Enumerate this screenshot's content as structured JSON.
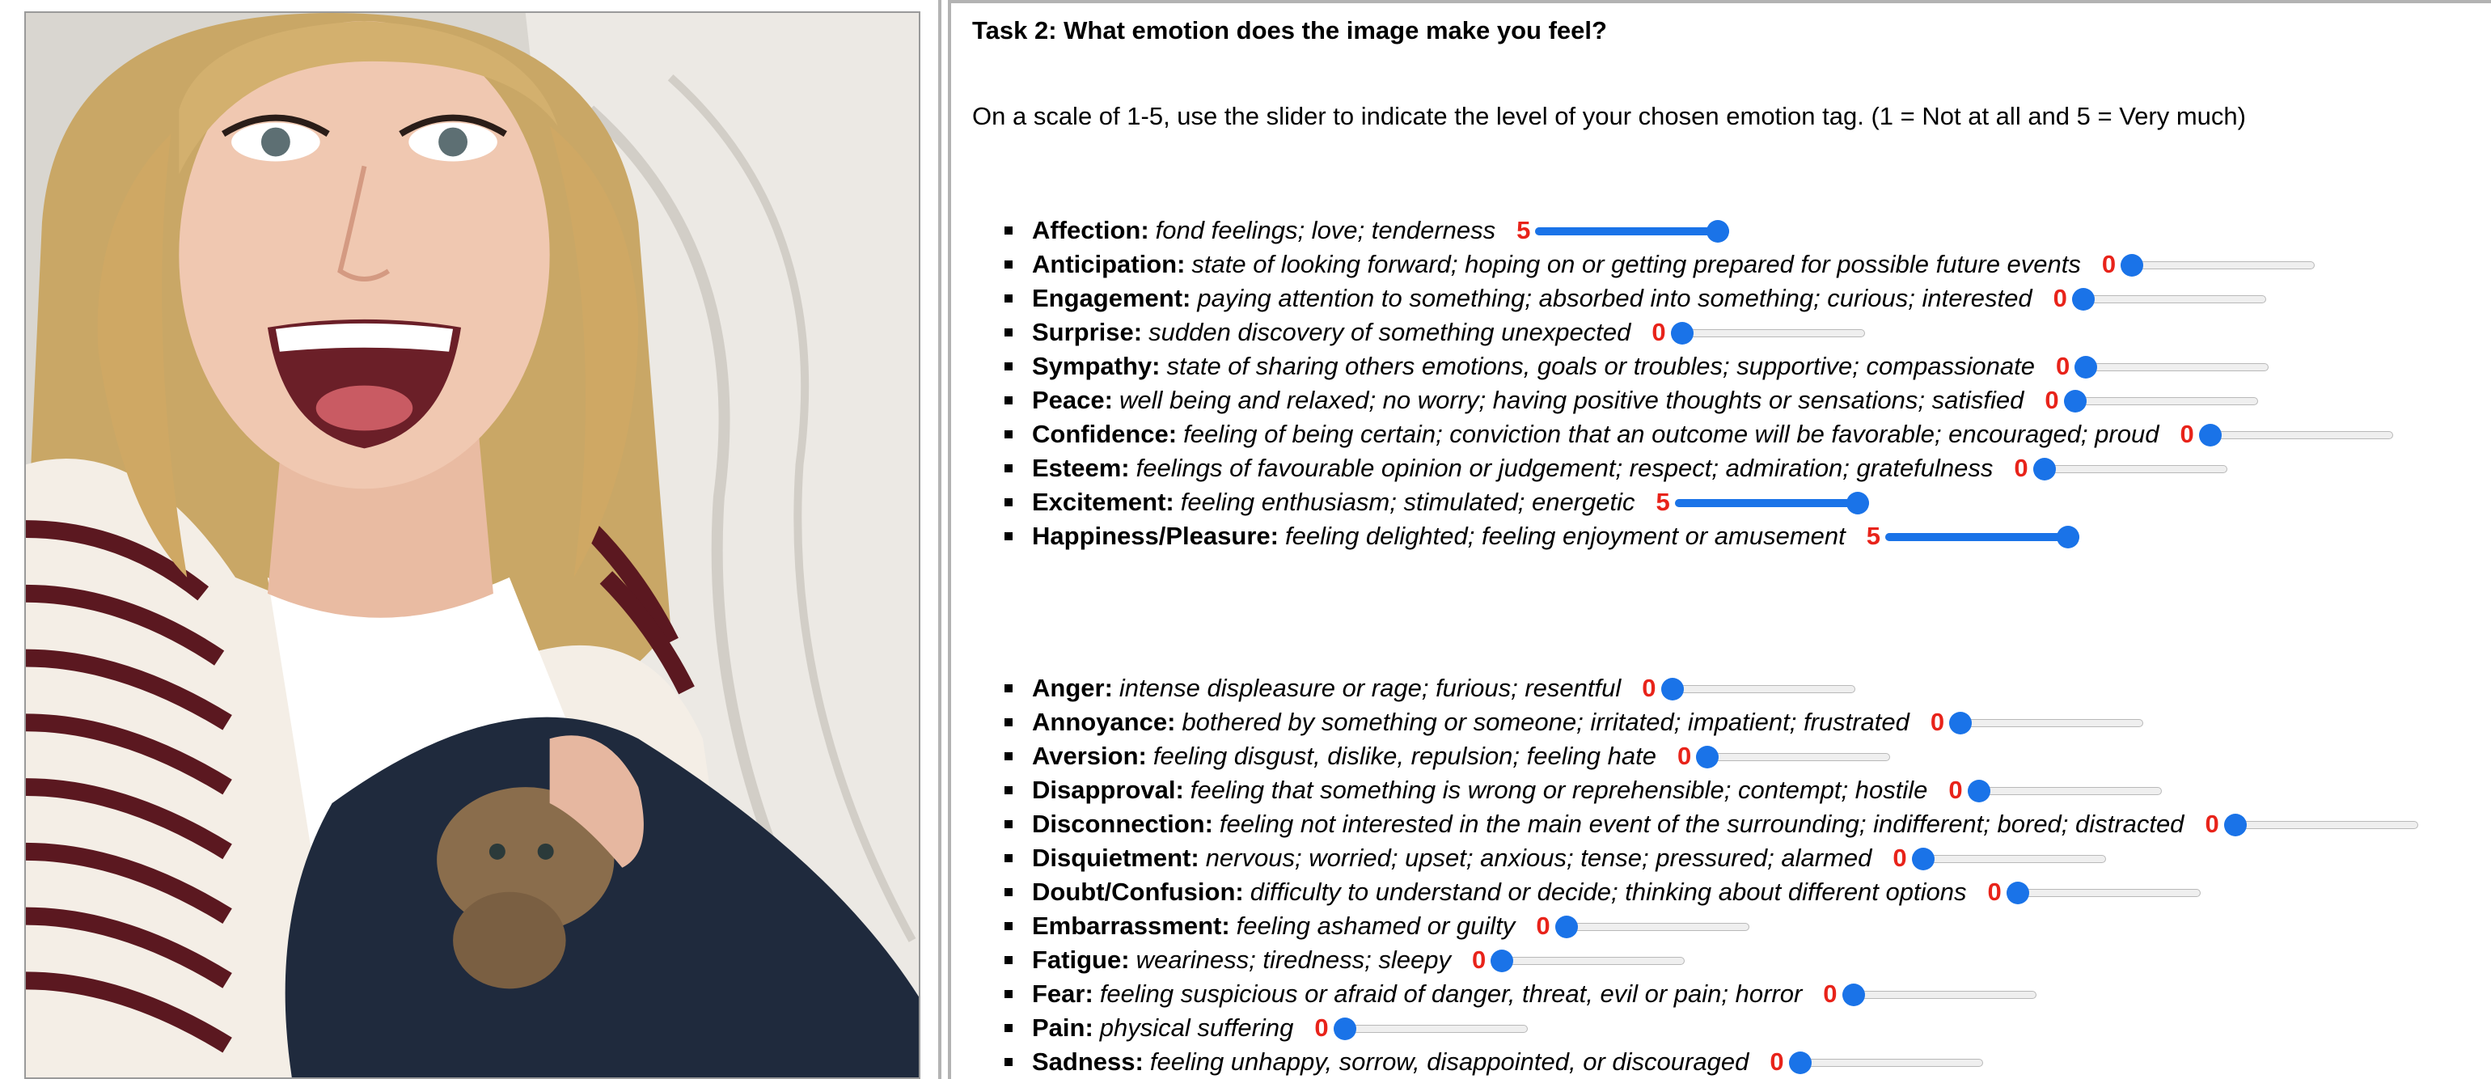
{
  "task": {
    "title": "Task 2: What emotion does the image make you feel?",
    "instructions": "On a scale of 1-5, use the slider to indicate the level of your chosen emotion tag. (1 = Not at all and 5 = Very much)"
  },
  "slider": {
    "min": 0,
    "max": 5
  },
  "colors": {
    "accent": "#1a73e8",
    "value_text": "#e8231a"
  },
  "positive_emotions": [
    {
      "name": "Affection:",
      "description": "fond feelings; love; tenderness",
      "value": "5"
    },
    {
      "name": "Anticipation:",
      "description": "state of looking forward; hoping on or getting prepared for possible future events",
      "value": "0"
    },
    {
      "name": "Engagement:",
      "description": "paying attention to something; absorbed into something; curious; interested",
      "value": "0"
    },
    {
      "name": "Surprise:",
      "description": "sudden discovery of something unexpected",
      "value": "0"
    },
    {
      "name": "Sympathy:",
      "description": "state of sharing others emotions, goals or troubles; supportive; compassionate",
      "value": "0"
    },
    {
      "name": "Peace:",
      "description": "well being and relaxed; no worry; having positive thoughts or sensations; satisfied",
      "value": "0"
    },
    {
      "name": "Confidence:",
      "description": "feeling of being certain; conviction that an outcome will be favorable; encouraged; proud",
      "value": "0"
    },
    {
      "name": "Esteem:",
      "description": "feelings of favourable opinion or judgement; respect; admiration; gratefulness",
      "value": "0"
    },
    {
      "name": "Excitement:",
      "description": "feeling enthusiasm; stimulated; energetic",
      "value": "5"
    },
    {
      "name": "Happiness/Pleasure:",
      "description": "feeling delighted; feeling enjoyment or amusement",
      "value": "5"
    }
  ],
  "negative_emotions": [
    {
      "name": "Anger:",
      "description": "intense displeasure or rage; furious; resentful",
      "value": "0"
    },
    {
      "name": "Annoyance:",
      "description": "bothered by something or someone; irritated; impatient; frustrated",
      "value": "0"
    },
    {
      "name": "Aversion:",
      "description": "feeling disgust, dislike, repulsion; feeling hate",
      "value": "0"
    },
    {
      "name": "Disapproval:",
      "description": "feeling that something is wrong or reprehensible; contempt; hostile",
      "value": "0"
    },
    {
      "name": "Disconnection:",
      "description": "feeling not interested in the main event of the surrounding; indifferent; bored; distracted",
      "value": "0"
    },
    {
      "name": "Disquietment:",
      "description": "nervous; worried; upset; anxious; tense; pressured; alarmed",
      "value": "0"
    },
    {
      "name": "Doubt/Confusion:",
      "description": "difficulty to understand or decide; thinking about different options",
      "value": "0"
    },
    {
      "name": "Embarrassment:",
      "description": "feeling ashamed or guilty",
      "value": "0"
    },
    {
      "name": "Fatigue:",
      "description": "weariness; tiredness; sleepy",
      "value": "0"
    },
    {
      "name": "Fear:",
      "description": "feeling suspicious or afraid of danger, threat, evil or pain; horror",
      "value": "0"
    },
    {
      "name": "Pain:",
      "description": "physical suffering",
      "value": "0"
    },
    {
      "name": "Sadness:",
      "description": "feeling unhappy, sorrow, disappointed, or discouraged",
      "value": "0"
    }
  ]
}
